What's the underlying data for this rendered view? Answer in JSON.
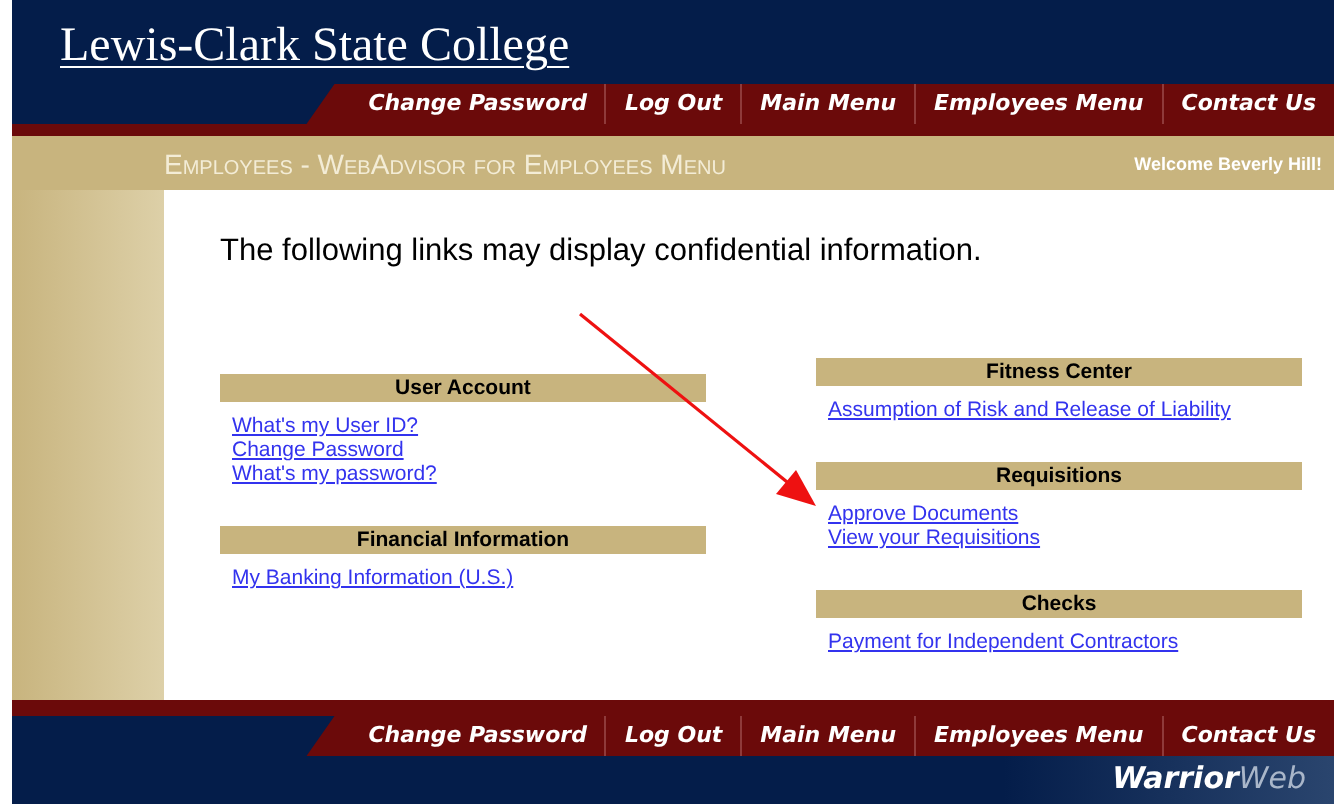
{
  "header": {
    "logo": "Lewis-Clark State College"
  },
  "top_nav": [
    "Change Password",
    "Log Out",
    "Main Menu",
    "Employees Menu",
    "Contact Us"
  ],
  "page_title": "Employees - WebAdvisor for Employees Menu",
  "welcome": "Welcome Beverly Hill!",
  "intro": "The following links may display confidential information.",
  "columns": [
    {
      "sections": [
        {
          "title": "User Account",
          "links": [
            "What's my User ID?",
            "Change Password",
            "What's my password?"
          ]
        },
        {
          "title": "Financial Information",
          "links": [
            "My Banking Information (U.S.)"
          ]
        }
      ]
    },
    {
      "sections": [
        {
          "title": "Fitness Center",
          "links": [
            "Assumption of Risk and Release of Liability"
          ]
        },
        {
          "title": "Requisitions",
          "links": [
            "Approve Documents",
            "View your Requisitions"
          ]
        },
        {
          "title": "Checks",
          "links": [
            "Payment for Independent Contractors"
          ]
        }
      ]
    }
  ],
  "footer_nav": [
    "Change Password",
    "Log Out",
    "Main Menu",
    "Employees Menu",
    "Contact Us"
  ],
  "footer": {
    "brand": [
      "Warrior",
      "Web"
    ]
  }
}
